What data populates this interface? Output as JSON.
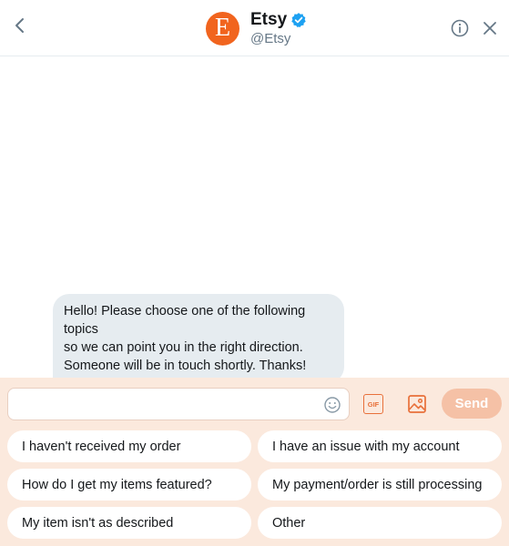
{
  "header": {
    "avatar_letter": "E",
    "display_name": "Etsy",
    "handle": "@Etsy",
    "verified": true,
    "icons": {
      "back": "chevron-left-icon",
      "info": "info-icon",
      "close": "close-icon",
      "verified": "verified-badge-icon"
    }
  },
  "colors": {
    "brand": "#f1641e",
    "composer_bg": "#fbe9dd",
    "send_disabled": "#f5c1a6",
    "bubble_bg": "#e6ecf0",
    "verified": "#1da1f2"
  },
  "conversation": {
    "messages": [
      {
        "from": "Etsy",
        "lines": [
          "Hello! Please choose one of the following topics",
          "so we can point you in the right direction.",
          "Someone will be in touch shortly. Thanks!"
        ]
      }
    ]
  },
  "composer": {
    "input_value": "",
    "input_placeholder": "",
    "send_label": "Send",
    "gif_label": "GIF",
    "icons": {
      "emoji": "emoji-icon",
      "media": "image-icon"
    }
  },
  "quick_replies": [
    "I haven't received my order",
    "I have an issue with my account",
    "How do I get my items featured?",
    "My payment/order is still processing",
    "My item isn't as described",
    "Other"
  ]
}
